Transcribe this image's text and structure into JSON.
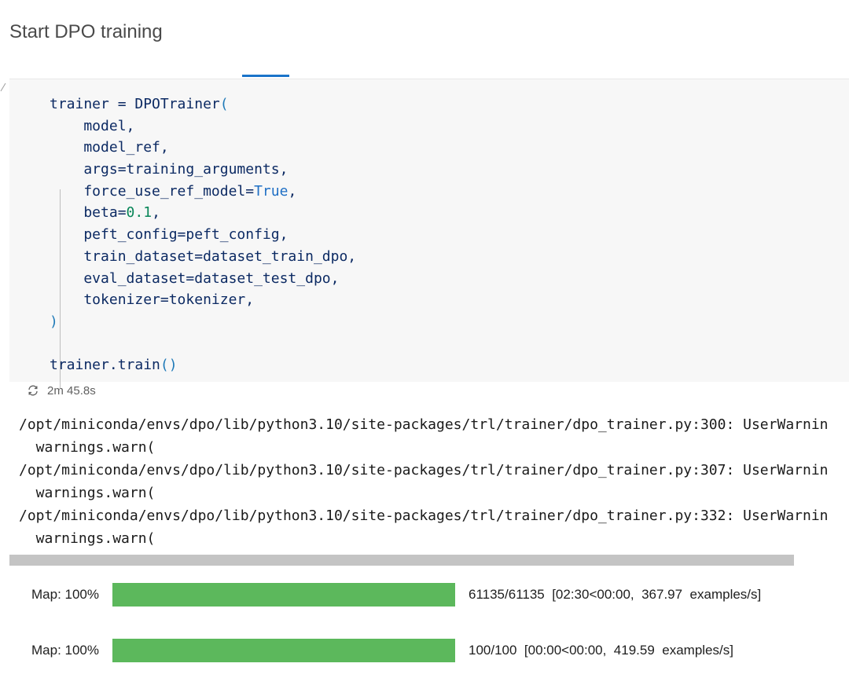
{
  "heading": "Start DPO training",
  "code_cell": {
    "lines": [
      {
        "segments": [
          {
            "t": "trainer = DPOTrainer"
          },
          {
            "t": "(",
            "c": "p-blue"
          }
        ]
      },
      {
        "segments": [
          {
            "t": "    model,"
          }
        ]
      },
      {
        "segments": [
          {
            "t": "    model_ref,"
          }
        ]
      },
      {
        "segments": [
          {
            "t": "    args=training_arguments,"
          }
        ]
      },
      {
        "segments": [
          {
            "t": "    force_use_ref_model="
          },
          {
            "t": "True",
            "c": "kw-blue"
          },
          {
            "t": ","
          }
        ]
      },
      {
        "segments": [
          {
            "t": "    beta="
          },
          {
            "t": "0.1",
            "c": "n-green"
          },
          {
            "t": ","
          }
        ]
      },
      {
        "segments": [
          {
            "t": "    peft_config=peft_config,"
          }
        ]
      },
      {
        "segments": [
          {
            "t": "    train_dataset=dataset_train_dpo,"
          }
        ]
      },
      {
        "segments": [
          {
            "t": "    eval_dataset=dataset_test_dpo,"
          }
        ]
      },
      {
        "segments": [
          {
            "t": "    tokenizer=tokenizer,"
          }
        ]
      },
      {
        "segments": [
          {
            "t": ")",
            "c": "p-blue"
          }
        ]
      },
      {
        "segments": [
          {
            "t": ""
          }
        ]
      },
      {
        "segments": [
          {
            "t": "trainer.train"
          },
          {
            "t": "()",
            "c": "p-blue"
          }
        ]
      }
    ]
  },
  "execution": {
    "status_icon": "refresh-icon",
    "duration": "2m 45.8s"
  },
  "output": {
    "lines": [
      "/opt/miniconda/envs/dpo/lib/python3.10/site-packages/trl/trainer/dpo_trainer.py:300: UserWarnin",
      "  warnings.warn(",
      "/opt/miniconda/envs/dpo/lib/python3.10/site-packages/trl/trainer/dpo_trainer.py:307: UserWarnin",
      "  warnings.warn(",
      "/opt/miniconda/envs/dpo/lib/python3.10/site-packages/trl/trainer/dpo_trainer.py:332: UserWarnin",
      "  warnings.warn("
    ]
  },
  "progress_bars": [
    {
      "label": "Map:  100%",
      "fraction": 1.0,
      "stats": "61135/61135  [02:30<00:00,  367.97  examples/s]"
    },
    {
      "label": "Map:  100%",
      "fraction": 1.0,
      "stats": "100/100  [00:00<00:00,  419.59  examples/s]"
    }
  ],
  "colors": {
    "progress_fill": "#5cb85c",
    "code_bg": "#f7f7f7",
    "accent": "#1a73c9"
  }
}
